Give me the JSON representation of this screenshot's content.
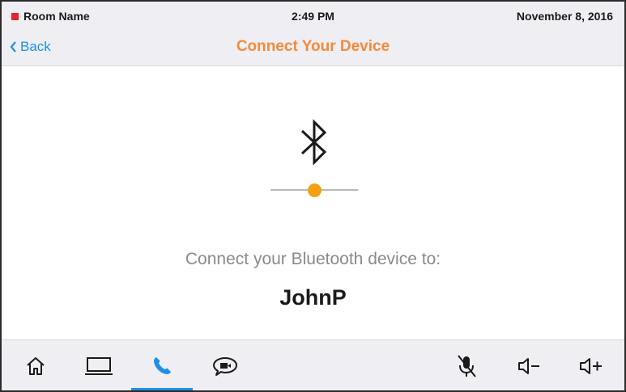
{
  "status_bar": {
    "room_name": "Room Name",
    "time": "2:49 PM",
    "date": "November 8, 2016",
    "room_indicator_color": "#e8232a"
  },
  "header": {
    "back_label": "Back",
    "title": "Connect Your Device"
  },
  "main": {
    "icon": "bluetooth-icon",
    "pairing_progress": 0.5,
    "prompt": "Connect your Bluetooth device to:",
    "device_name": "JohnP"
  },
  "bottom_nav": {
    "items": [
      {
        "icon": "home-icon",
        "active": false
      },
      {
        "icon": "laptop-icon",
        "active": false
      },
      {
        "icon": "phone-icon",
        "active": true
      },
      {
        "icon": "video-chat-icon",
        "active": false
      },
      {
        "icon": "mic-muted-icon",
        "active": false
      },
      {
        "icon": "volume-down-icon",
        "active": false
      },
      {
        "icon": "volume-up-icon",
        "active": false
      }
    ]
  },
  "colors": {
    "accent_blue": "#1e8ee8",
    "title_orange": "#f58a3b",
    "progress_orange": "#f3a112",
    "bar_background": "#efeff3"
  }
}
